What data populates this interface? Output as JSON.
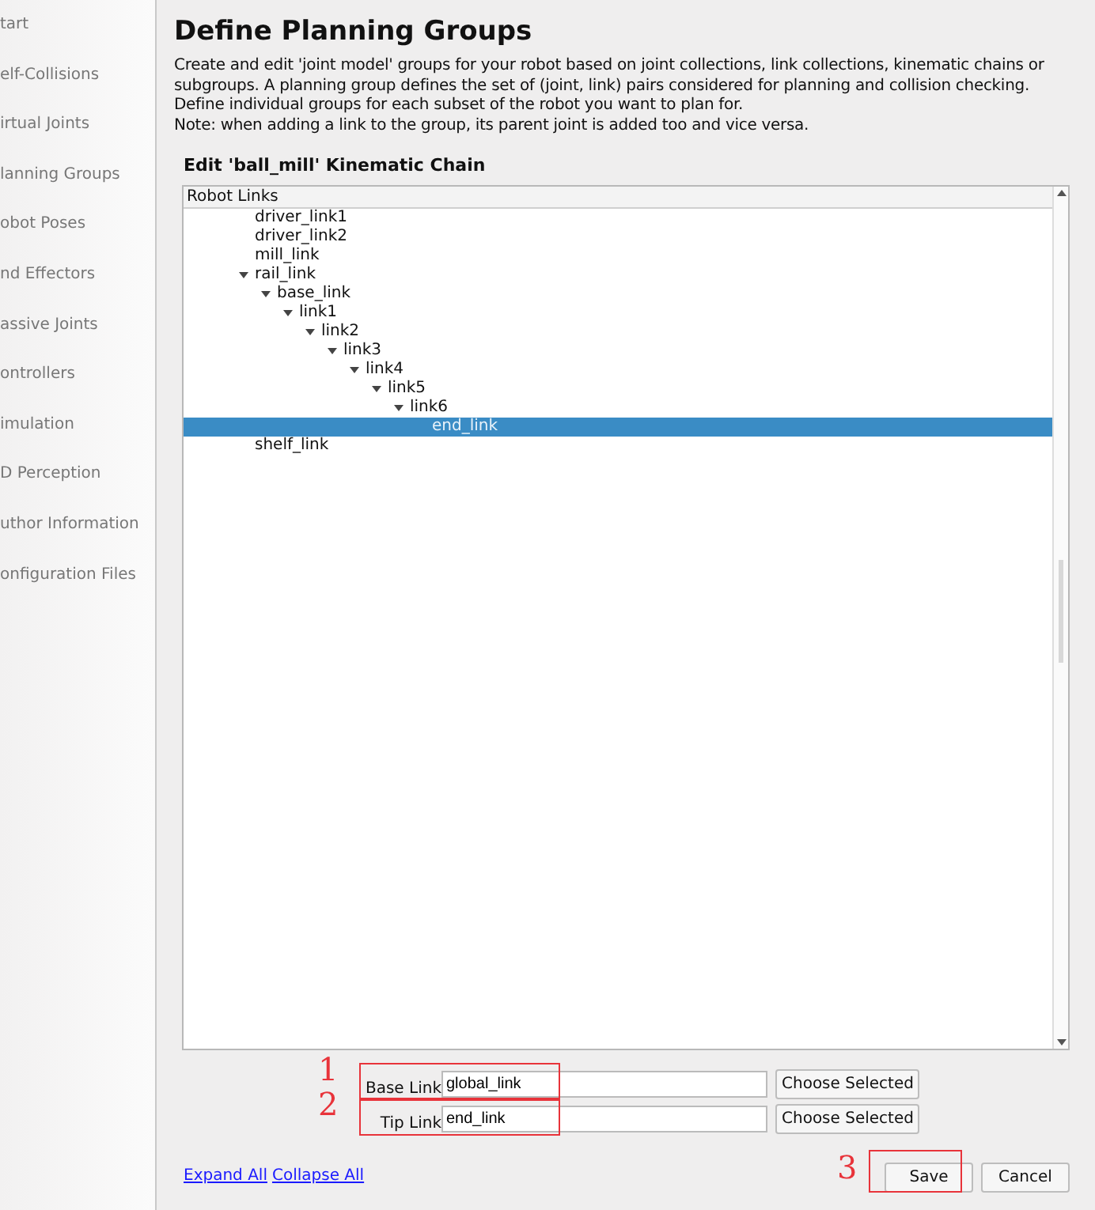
{
  "sidebar": {
    "items": [
      {
        "label": "tart"
      },
      {
        "label": "elf-Collisions"
      },
      {
        "label": "irtual Joints"
      },
      {
        "label": "lanning Groups"
      },
      {
        "label": "obot Poses"
      },
      {
        "label": "nd Effectors"
      },
      {
        "label": "assive Joints"
      },
      {
        "label": "ontrollers"
      },
      {
        "label": "imulation"
      },
      {
        "label": "D Perception"
      },
      {
        "label": "uthor Information"
      },
      {
        "label": "onfiguration Files"
      }
    ]
  },
  "page": {
    "title": "Define Planning Groups",
    "description": "Create and edit 'joint model' groups for your robot based on joint collections, link collections, kinematic chains or subgroups. A planning group defines the set of (joint, link) pairs considered for planning and collision checking. Define individual groups for each subset of the robot you want to plan for.",
    "note": "Note: when adding a link to the group, its parent joint is added too and vice versa."
  },
  "editor": {
    "title": "Edit 'ball_mill' Kinematic Chain"
  },
  "tree": {
    "header": "Robot Links",
    "items": [
      {
        "label": "driver_link1",
        "selected": false
      },
      {
        "label": "driver_link2",
        "selected": false
      },
      {
        "label": "mill_link",
        "selected": false
      },
      {
        "label": "rail_link",
        "selected": false,
        "expanded": true,
        "children": [
          {
            "label": "base_link",
            "selected": false,
            "expanded": true,
            "children": [
              {
                "label": "link1",
                "selected": false,
                "expanded": true,
                "children": [
                  {
                    "label": "link2",
                    "selected": false,
                    "expanded": true,
                    "children": [
                      {
                        "label": "link3",
                        "selected": false,
                        "expanded": true,
                        "children": [
                          {
                            "label": "link4",
                            "selected": false,
                            "expanded": true,
                            "children": [
                              {
                                "label": "link5",
                                "selected": false,
                                "expanded": true,
                                "children": [
                                  {
                                    "label": "link6",
                                    "selected": false,
                                    "expanded": true,
                                    "children": [
                                      {
                                        "label": "end_link",
                                        "selected": true
                                      }
                                    ]
                                  }
                                ]
                              }
                            ]
                          }
                        ]
                      }
                    ]
                  }
                ]
              }
            ]
          }
        ]
      },
      {
        "label": "shelf_link",
        "selected": false
      }
    ]
  },
  "form": {
    "rows": [
      {
        "label": "Base Link",
        "value": "global_link",
        "button": "Choose Selected",
        "annotation": "1"
      },
      {
        "label": "Tip Link",
        "value": "end_link",
        "button": "Choose Selected",
        "annotation": "2"
      }
    ]
  },
  "footer": {
    "links": [
      "Expand All",
      "Collapse All"
    ],
    "buttons": [
      {
        "label": "Save",
        "annotation": "3"
      },
      {
        "label": "Cancel"
      }
    ]
  }
}
